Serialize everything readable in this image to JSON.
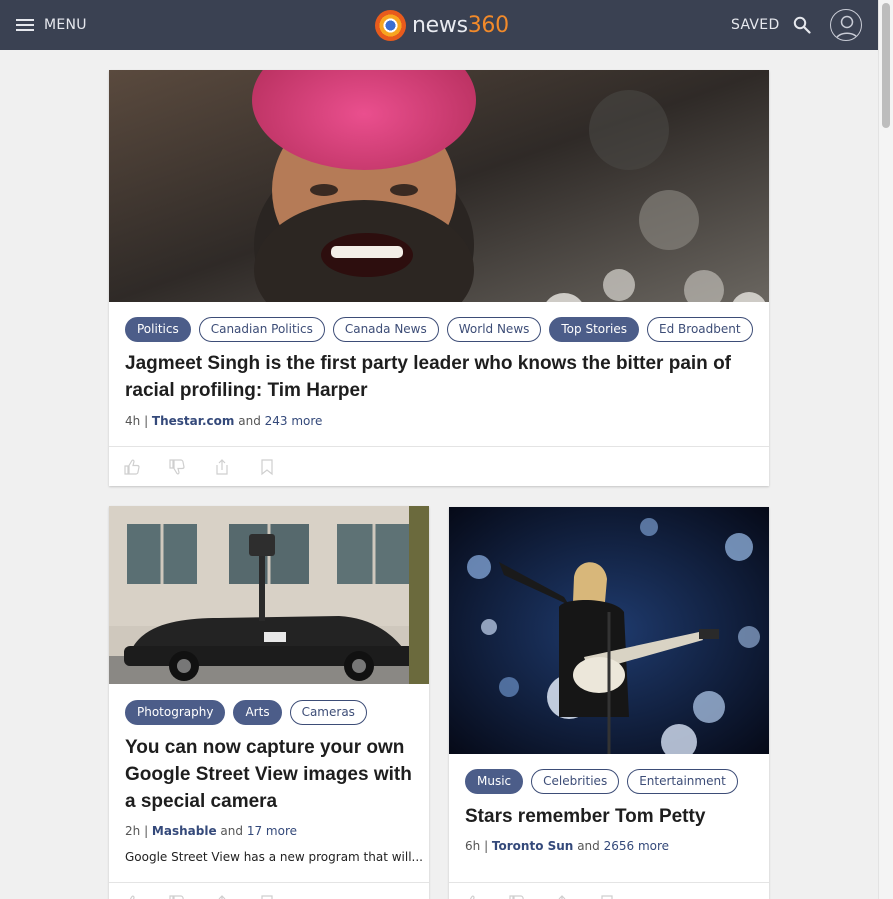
{
  "header": {
    "menu_label": "MENU",
    "logo_word": "news",
    "logo_num": "360",
    "saved_label": "SAVED"
  },
  "icons": {
    "menu": "hamburger-icon",
    "search": "search-icon",
    "account": "user-avatar-icon",
    "like": "thumbs-up-icon",
    "dislike": "thumbs-down-icon",
    "share": "share-icon",
    "save": "bookmark-icon"
  },
  "colors": {
    "topbar": "#3a4152",
    "tag_accent": "#3d4d77",
    "tag_filled": "#4c5d89",
    "logo_orange": "#f28a2a"
  },
  "cards": [
    {
      "tags": [
        {
          "label": "Politics",
          "filled": true
        },
        {
          "label": "Canadian Politics",
          "filled": false
        },
        {
          "label": "Canada News",
          "filled": false
        },
        {
          "label": "World News",
          "filled": false
        },
        {
          "label": "Top Stories",
          "filled": true
        },
        {
          "label": "Ed Broadbent",
          "filled": false
        }
      ],
      "title": "Jagmeet Singh is the first party leader who knows the bitter pain of racial profiling: Tim Harper",
      "age": "4h",
      "source": "Thestar.com",
      "and": "and",
      "more": "243 more"
    },
    {
      "tags": [
        {
          "label": "Photography",
          "filled": true
        },
        {
          "label": "Arts",
          "filled": true
        },
        {
          "label": "Cameras",
          "filled": false
        }
      ],
      "title": "You can now capture your own Google Street View images with a special camera",
      "age": "2h",
      "source": "Mashable",
      "and": "and",
      "more": "17 more",
      "snippet": "Google Street View has a new program that will..."
    },
    {
      "tags": [
        {
          "label": "Music",
          "filled": true
        },
        {
          "label": "Celebrities",
          "filled": false
        },
        {
          "label": "Entertainment",
          "filled": false
        }
      ],
      "title": "Stars remember Tom Petty",
      "age": "6h",
      "source": "Toronto Sun",
      "and": "and",
      "more": "2656 more"
    }
  ]
}
